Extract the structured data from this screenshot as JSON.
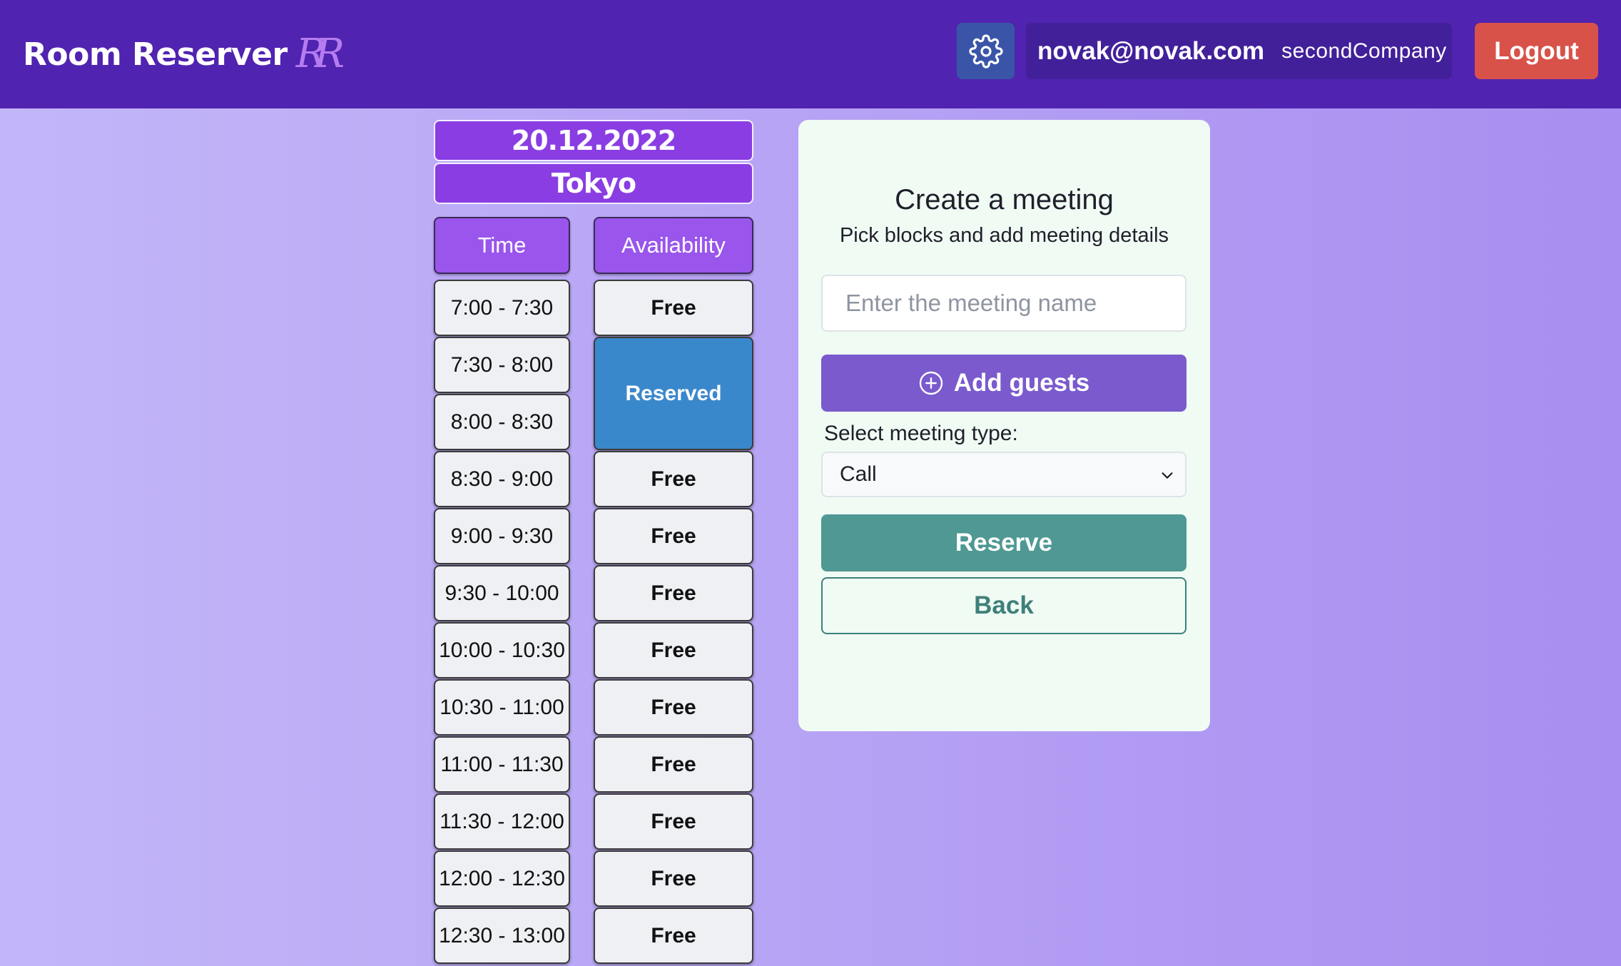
{
  "app": {
    "title": "Room Reserver",
    "logo_text": "RR"
  },
  "header": {
    "settings_icon": "gear-icon",
    "user_email": "novak@novak.com",
    "company": "secondCompany",
    "logout_label": "Logout"
  },
  "schedule": {
    "date": "20.12.2022",
    "room": "Tokyo",
    "time_header": "Time",
    "availability_header": "Availability",
    "slots": [
      {
        "time": "7:00 - 7:30",
        "status": "Free"
      },
      {
        "time": "7:30 - 8:00",
        "status": "Reserved"
      },
      {
        "time": "8:00 - 8:30",
        "status": "Reserved"
      },
      {
        "time": "8:30 - 9:00",
        "status": "Free"
      },
      {
        "time": "9:00 - 9:30",
        "status": "Free"
      },
      {
        "time": "9:30 - 10:00",
        "status": "Free"
      },
      {
        "time": "10:00 - 10:30",
        "status": "Free"
      },
      {
        "time": "10:30 - 11:00",
        "status": "Free"
      },
      {
        "time": "11:00 - 11:30",
        "status": "Free"
      },
      {
        "time": "11:30 - 12:00",
        "status": "Free"
      },
      {
        "time": "12:00 - 12:30",
        "status": "Free"
      },
      {
        "time": "12:30 - 13:00",
        "status": "Free"
      }
    ]
  },
  "meeting_form": {
    "title": "Create a meeting",
    "subtitle": "Pick blocks and add meeting details",
    "name_placeholder": "Enter the meeting name",
    "name_value": "",
    "add_guests_label": "Add guests",
    "add_guests_icon": "plus-circle-icon",
    "type_label": "Select meeting type:",
    "type_selected": "Call",
    "reserve_label": "Reserve",
    "back_label": "Back"
  },
  "colors": {
    "header_bg": "#5023b0",
    "reserved": "#3a88cc",
    "reserve_button": "#4f9893",
    "logout_button": "#d8524a",
    "add_guests_button": "#7a5acd"
  }
}
